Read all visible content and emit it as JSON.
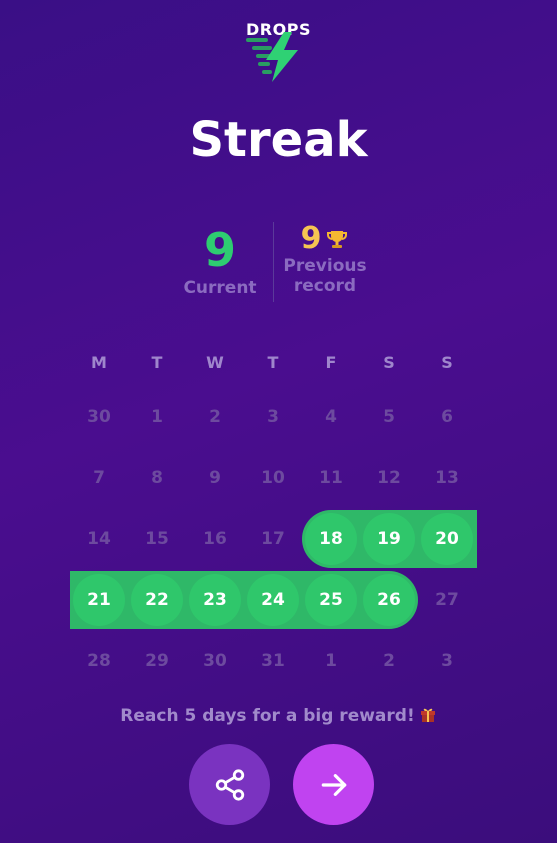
{
  "brand": "DROPS",
  "title": "Streak",
  "stats": {
    "current_value": "9",
    "current_label": "Current",
    "record_value": "9",
    "record_label_line1": "Previous",
    "record_label_line2": "record"
  },
  "calendar": {
    "weekdays": [
      "M",
      "T",
      "W",
      "T",
      "F",
      "S",
      "S"
    ],
    "weeks": [
      [
        "30",
        "1",
        "2",
        "3",
        "4",
        "5",
        "6"
      ],
      [
        "7",
        "8",
        "9",
        "10",
        "11",
        "12",
        "13"
      ],
      [
        "14",
        "15",
        "16",
        "17",
        "18",
        "19",
        "20"
      ],
      [
        "21",
        "22",
        "23",
        "24",
        "25",
        "26",
        "27"
      ],
      [
        "28",
        "29",
        "30",
        "31",
        "1",
        "2",
        "3"
      ]
    ],
    "streak_days": [
      "18",
      "19",
      "20",
      "21",
      "22",
      "23",
      "24",
      "25",
      "26"
    ]
  },
  "reward_text": "Reach 5 days for a big reward!",
  "icons": {
    "logo": "drops-lightning-logo",
    "trophy": "trophy-icon",
    "gift": "gift-icon",
    "share": "share-icon",
    "next": "arrow-right-icon"
  },
  "colors": {
    "background": "#3f0e88",
    "streak_green": "#2fc76b",
    "record_gold": "#f5c452",
    "share_button": "#7a33c0",
    "next_button": "#c043f0"
  }
}
